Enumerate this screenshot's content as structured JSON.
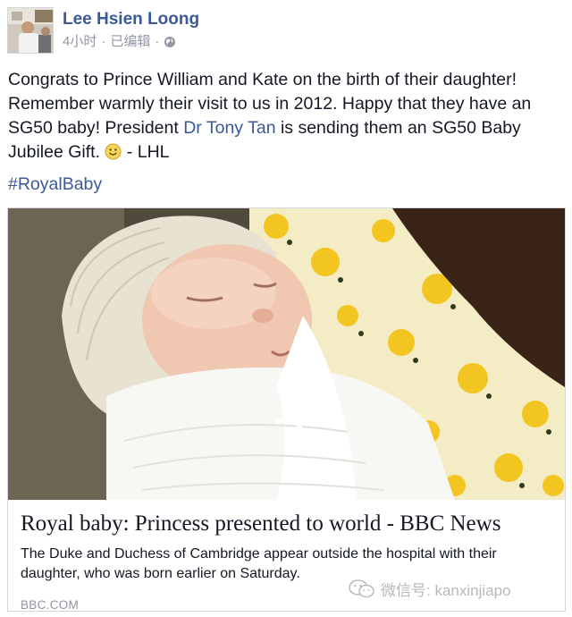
{
  "post": {
    "author": "Lee Hsien Loong",
    "time": "4小时",
    "separator": "·",
    "edited": "已编辑",
    "privacy_icon": "globe-icon",
    "body_part1": "Congrats to Prince William and Kate on the birth of their daughter! Remember warmly their visit to us in 2012. Happy that they have an SG50 baby! President ",
    "body_link": "Dr Tony Tan",
    "body_part2": " is sending them an SG50 Baby Jubilee Gift. ",
    "emoji_icon": "smile-emoji-icon",
    "body_part3": " - LHL",
    "hashtag": "#RoyalBaby"
  },
  "share": {
    "title": "Royal baby: Princess presented to world - BBC News",
    "description": "The Duke and Duchess of Cambridge appear outside the hospital with their daughter, who was born earlier on Saturday.",
    "source": "BBC.COM"
  },
  "watermark": {
    "text": "微信号: kanxinjiapo",
    "icon": "wechat-icon"
  },
  "colors": {
    "link": "#3b5998",
    "meta": "#9197a3",
    "text": "#141823"
  }
}
